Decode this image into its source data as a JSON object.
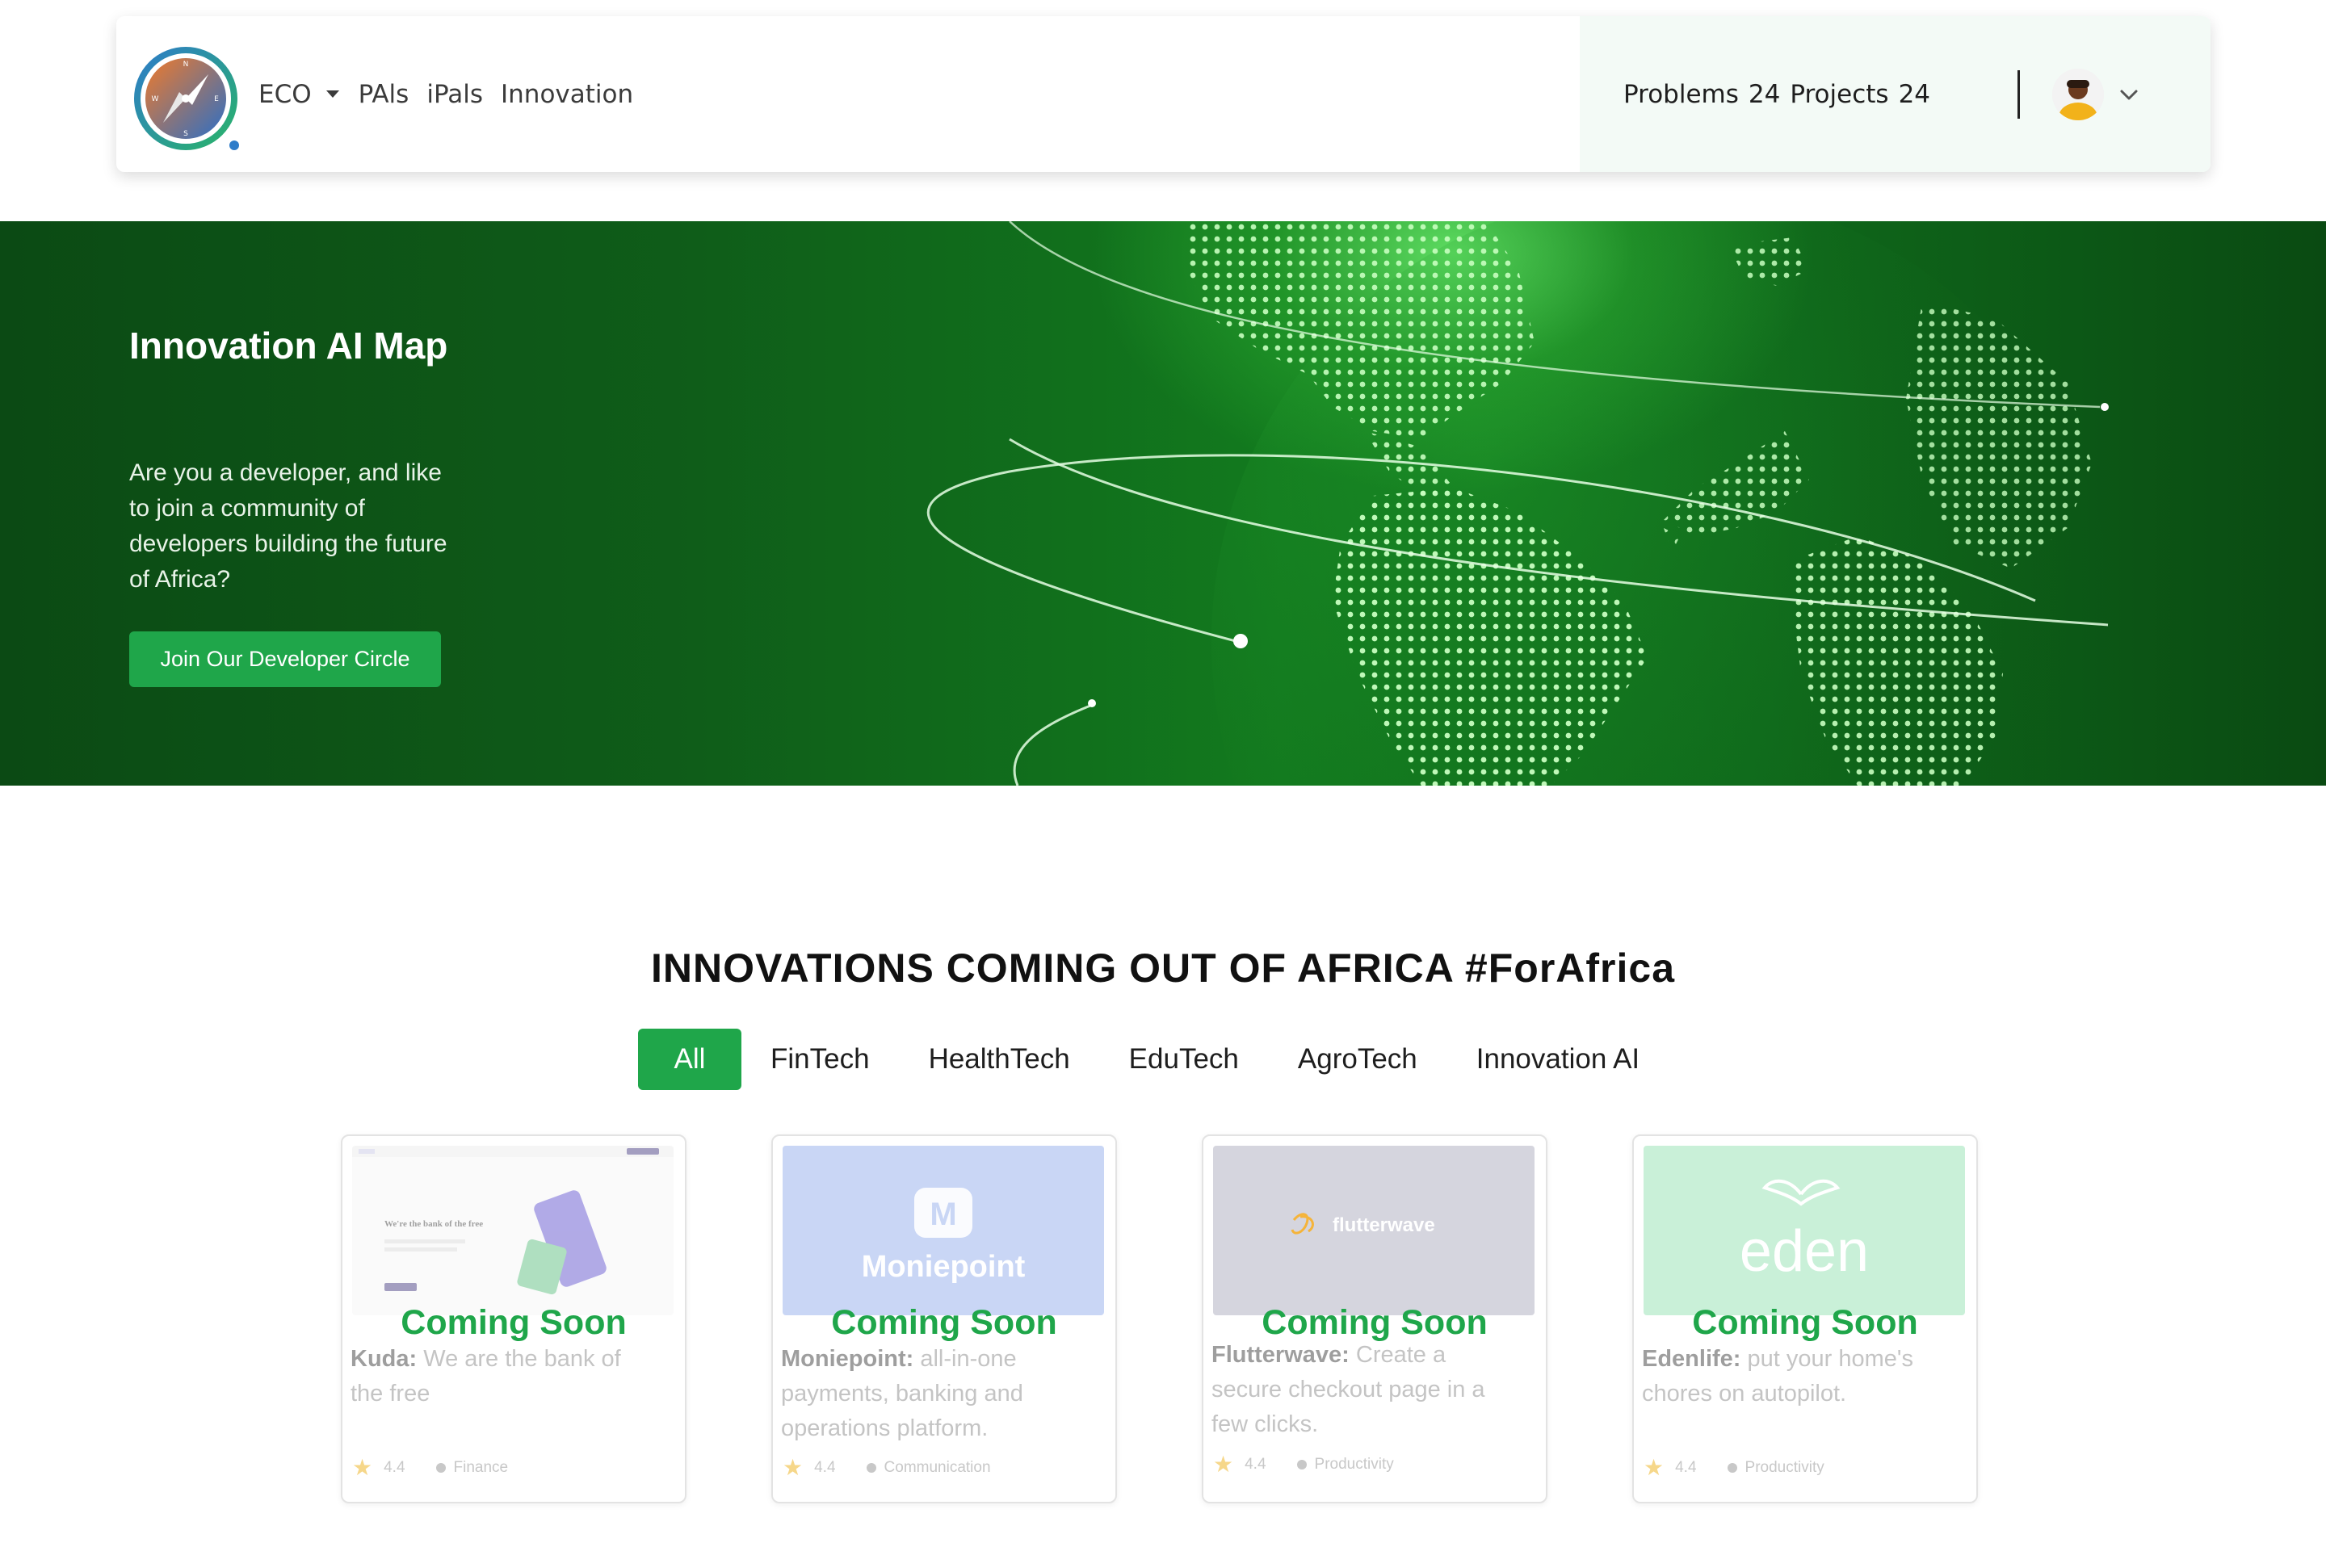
{
  "navbar": {
    "links": [
      {
        "label": "ECO",
        "has_dropdown": true
      },
      {
        "label": "PAls",
        "has_dropdown": false
      },
      {
        "label": "iPals",
        "has_dropdown": false
      },
      {
        "label": "Innovation",
        "has_dropdown": false
      }
    ],
    "problems_label": "Problems",
    "problems_count": "24",
    "projects_label": "Projects",
    "projects_count": "24",
    "logo_compass_letters": [
      "N",
      "E",
      "S",
      "W"
    ],
    "avatar_icon": "user-avatar",
    "menu_icon": "chevron-down-icon"
  },
  "hero": {
    "title": "Innovation AI Map",
    "text": "Are you a developer, and like to join a community of developers building the future of Africa?",
    "cta_label": "Join Our Developer Circle"
  },
  "section": {
    "title": "INNOVATIONS COMING OUT OF AFRICA #ForAfrica",
    "tabs": [
      "All",
      "FinTech",
      "HealthTech",
      "EduTech",
      "AgroTech",
      "Innovation AI"
    ],
    "active_tab": "All"
  },
  "cards": [
    {
      "status": "Coming Soon",
      "name": "Kuda:",
      "desc": "We are the bank of the free",
      "rating": "4.4",
      "category": "Finance",
      "image_text": "We're the bank of the free"
    },
    {
      "status": "Coming Soon",
      "name": "Moniepoint:",
      "desc": "all-in-one payments, banking and operations platform.",
      "rating": "4.4",
      "category": "Communication",
      "image_text": "Moniepoint"
    },
    {
      "status": "Coming Soon",
      "name": "Flutterwave:",
      "desc": "Create a secure checkout page in a few clicks.",
      "rating": "4.4",
      "category": "Productivity",
      "image_text": "flutterwave"
    },
    {
      "status": "Coming Soon",
      "name": "Edenlife:",
      "desc": "put your home's chores on autopilot.",
      "rating": "4.4",
      "category": "Productivity",
      "image_text": "eden"
    }
  ],
  "colors": {
    "accent_green": "#1fa64a",
    "hero_dark": "#0b4a14",
    "nav_right_bg": "#f3faf6"
  }
}
